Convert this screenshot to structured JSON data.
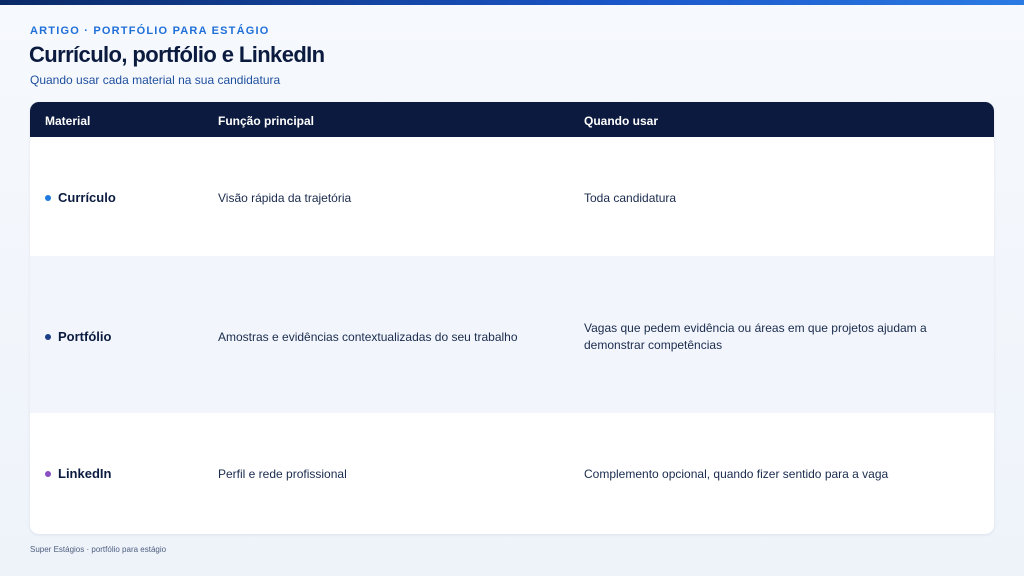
{
  "header": {
    "eyebrow": "ARTIGO · PORTFÓLIO PARA ESTÁGIO",
    "title": "Currículo, portfólio e LinkedIn",
    "subtitle": "Quando usar cada material na sua candidatura"
  },
  "table": {
    "columns": [
      "Material",
      "Função principal",
      "Quando usar"
    ],
    "rows": [
      {
        "material": "Currículo",
        "dot_color": "#1f7ae0",
        "function": "Visão rápida da trajetória",
        "when": "Toda candidatura"
      },
      {
        "material": "Portfólio",
        "dot_color": "#1c3f86",
        "function": "Amostras e evidências contextualizadas do seu trabalho",
        "when": "Vagas que pedem evidência ou áreas em que projetos ajudam a demonstrar competências"
      },
      {
        "material": "LinkedIn",
        "dot_color": "#8a4fc0",
        "function": "Perfil e rede profissional",
        "when": "Complemento opcional, quando fizer sentido para a vaga"
      }
    ]
  },
  "footer": {
    "text": "Super Estágios · portfólio para estágio"
  }
}
